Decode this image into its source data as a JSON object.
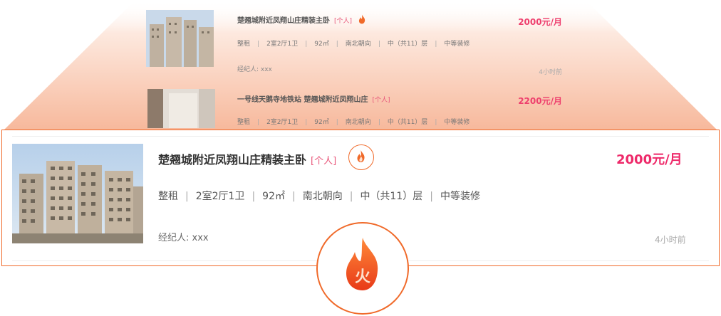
{
  "listings": [
    {
      "title": "楚翘城附近凤翔山庄精装主卧",
      "tag": "[个人]",
      "price": "2000元/月",
      "meta": [
        "整租",
        "2室2厅1卫",
        "92㎡",
        "南北朝向",
        "中（共11）层",
        "中等装修"
      ],
      "agent": "经纪人: xxx",
      "time": "4小时前",
      "hot_icon": "fire-icon"
    },
    {
      "title": "一号线天鹅寺地铁站 楚翘城附近凤翔山庄",
      "tag": "[个人]",
      "price": "2200元/月",
      "meta": [
        "整租",
        "2室2厅1卫",
        "92㎡",
        "南北朝向",
        "中（共11）层",
        "中等装修"
      ]
    }
  ],
  "featured": {
    "title": "楚翘城附近凤翔山庄精装主卧",
    "tag": "[个人]",
    "price": "2000元/月",
    "meta": [
      "整租",
      "2室2厅1卫",
      "92㎡",
      "南北朝向",
      "中（共11）层",
      "中等装修"
    ],
    "agent": "经纪人: xxx",
    "time": "4小时前",
    "hot_icon": "fire-icon",
    "zoom_glyph": "火"
  },
  "colors": {
    "accent": "#f06a2a",
    "price": "#ee2a6a",
    "tag": "#e8577a"
  }
}
